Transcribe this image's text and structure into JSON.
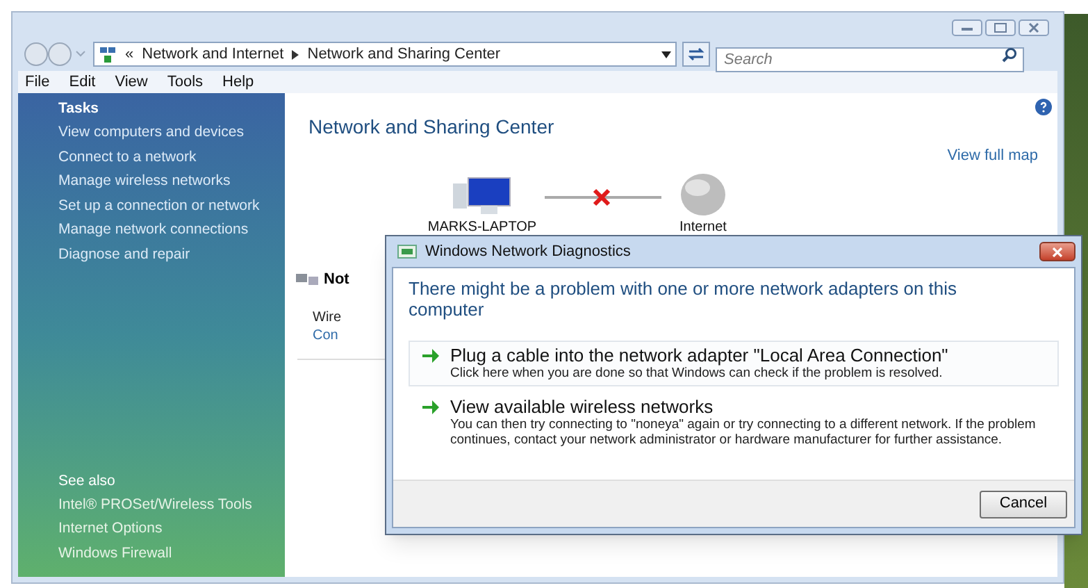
{
  "address_bar": {
    "prefix": "«",
    "breadcrumbs": [
      "Network and Internet",
      "Network and Sharing Center"
    ]
  },
  "search": {
    "placeholder": "Search"
  },
  "menu": [
    "File",
    "Edit",
    "View",
    "Tools",
    "Help"
  ],
  "sidebar": {
    "tasks_title": "Tasks",
    "tasks": [
      "View computers and devices",
      "Connect to a network",
      "Manage wireless networks",
      "Set up a connection or network",
      "Manage network connections",
      "Diagnose and repair"
    ],
    "see_also_title": "See also",
    "see_also": [
      "Intel® PROSet/Wireless Tools",
      "Internet Options",
      "Windows Firewall"
    ]
  },
  "content": {
    "title": "Network and Sharing Center",
    "view_full_map": "View full map",
    "map": {
      "computer": "MARKS-LAPTOP",
      "internet": "Internet",
      "connected": false
    },
    "partial": {
      "heading": "Not",
      "line_1": "Wire",
      "line_2": "Con"
    }
  },
  "dialog": {
    "title": "Windows Network Diagnostics",
    "message": "There might be a problem with one or more network adapters on this computer",
    "options": [
      {
        "title": "Plug a cable into the network adapter \"Local Area Connection\"",
        "description": "Click here when you are done so that Windows can check if the problem is resolved.",
        "highlighted": true
      },
      {
        "title": "View available wireless networks",
        "description": "You can then try connecting to \"noneya\" again or try connecting to a different network. If the problem continues, contact your network administrator or hardware manufacturer for further assistance.",
        "highlighted": false
      }
    ],
    "cancel": "Cancel"
  }
}
